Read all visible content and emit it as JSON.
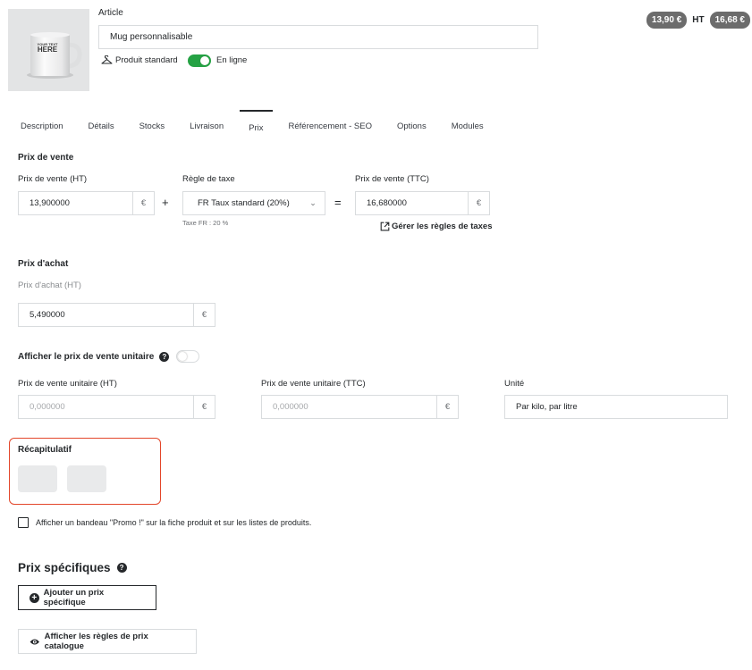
{
  "header": {
    "article_label": "Article",
    "product_name": "Mug personnalisable",
    "product_type": "Produit standard",
    "online_label": "En ligne",
    "online_enabled": true,
    "image_text_line1": "YOUR TEXT",
    "image_text_line2": "HERE",
    "price_ht": "13,90 €",
    "ht_label": "HT",
    "price_ttc": "16,68 €"
  },
  "tabs": [
    {
      "label": "Description",
      "active": false
    },
    {
      "label": "Détails",
      "active": false
    },
    {
      "label": "Stocks",
      "active": false
    },
    {
      "label": "Livraison",
      "active": false
    },
    {
      "label": "Prix",
      "active": true
    },
    {
      "label": "Référencement - SEO",
      "active": false
    },
    {
      "label": "Options",
      "active": false
    },
    {
      "label": "Modules",
      "active": false
    }
  ],
  "sale_price": {
    "title": "Prix de vente",
    "ht_label": "Prix de vente (HT)",
    "ht_value": "13,900000",
    "currency": "€",
    "plus": "+",
    "tax_rule_label": "Règle de taxe",
    "tax_rule_value": "FR Taux standard (20%)",
    "tax_hint": "Taxe FR : 20 %",
    "equals": "=",
    "ttc_label": "Prix de vente (TTC)",
    "ttc_value": "16,680000",
    "manage_tax_link": "Gérer les règles de taxes"
  },
  "purchase_price": {
    "title": "Prix d'achat",
    "label": "Prix d'achat (HT)",
    "value": "5,490000",
    "currency": "€"
  },
  "unit_price": {
    "title": "Afficher le prix de vente unitaire",
    "help": "?",
    "enabled": false,
    "ht_label": "Prix de vente unitaire (HT)",
    "ht_placeholder": "0,000000",
    "ttc_label": "Prix de vente unitaire (TTC)",
    "ttc_placeholder": "0,000000",
    "unit_label": "Unité",
    "unit_value": "Par kilo, par litre",
    "currency": "€"
  },
  "summary": {
    "title": "Récapitulatif"
  },
  "promo": {
    "label": "Afficher un bandeau \"Promo !\" sur la fiche produit et sur les listes de produits."
  },
  "specific_prices": {
    "title": "Prix spécifiques",
    "help": "?",
    "add_button": "Ajouter un prix spécifique",
    "add_icon": "+",
    "catalog_button": "Afficher les règles de prix catalogue"
  },
  "colors": {
    "toggle_on": "#25a244",
    "highlight_border": "#e3462a",
    "badge_bg": "#6c6c6c"
  }
}
